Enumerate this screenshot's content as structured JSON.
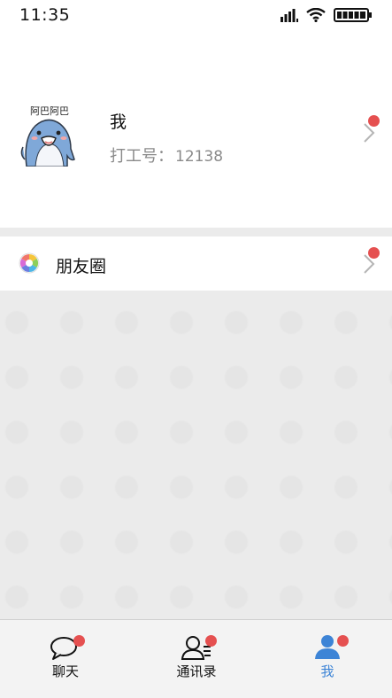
{
  "status_bar": {
    "time": "11:35"
  },
  "profile": {
    "avatar_caption": "阿巴阿巴",
    "name": "我",
    "id_label": "打工号：",
    "id_value": "12138"
  },
  "moments": {
    "label": "朋友圈"
  },
  "tabs": [
    {
      "label": "聊天",
      "icon": "chat-bubble-icon",
      "active": false
    },
    {
      "label": "通讯录",
      "icon": "contacts-icon",
      "active": false
    },
    {
      "label": "我",
      "icon": "person-icon",
      "active": true
    }
  ],
  "colors": {
    "badge": "#e55050",
    "active_tab": "#3d84d6",
    "background": "#ebebeb"
  }
}
